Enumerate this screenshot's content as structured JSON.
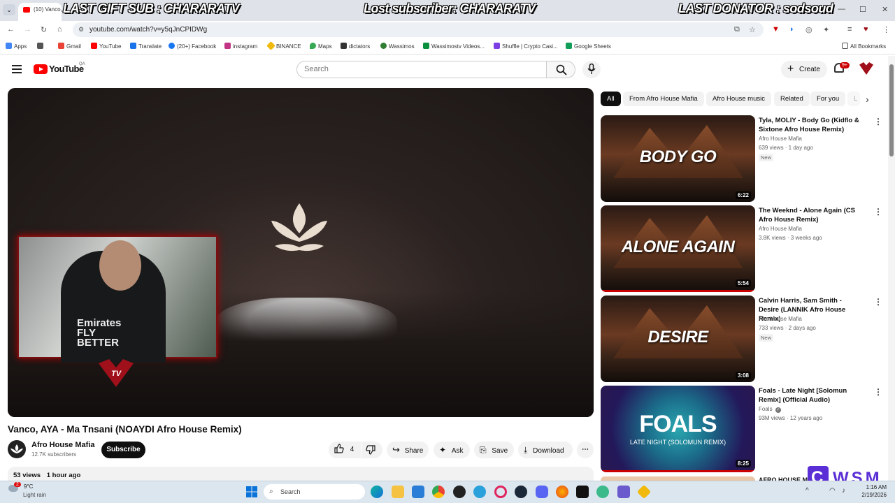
{
  "browser": {
    "tab_title": "(10) Vanco,",
    "banners": {
      "left": "LAST GIFT SUB : CHARARATV",
      "center": "Lost subscriber: CHARARATV",
      "right": "LAST DONATOR : sodsoud"
    },
    "url": "youtube.com/watch?v=y5qJnCPIDWg",
    "bookmarks": [
      "Apps",
      "Gmail",
      "YouTube",
      "Translate",
      "(20+) Facebook",
      "instagram",
      "BINANCE",
      "Maps",
      "dictators",
      "Wassimos",
      "Wassimostv Videos...",
      "Shuffle | Crypto Casi...",
      "Google Sheets"
    ],
    "all_bookmarks": "All Bookmarks",
    "bookmark_colors": [
      "#4285f4",
      "#ea4335",
      "#ff0000",
      "#1a73e8",
      "#1877f2",
      "#c13584",
      "#f0b90b",
      "#34a853",
      "#333333",
      "#2e7d32",
      "#0a8f3c",
      "#7b3fe4",
      "#0f9d58"
    ]
  },
  "youtube": {
    "logo_text": "YouTube",
    "region": "QA",
    "search_placeholder": "Search",
    "create_label": "Create",
    "notif_count": "9+"
  },
  "video": {
    "title": "Vanco, AYA - Ma Tnsani (NOAYDI Afro House Remix)",
    "channel": "Afro House Mafia",
    "subscribers": "12.7K subscribers",
    "subscribe_label": "Subscribe",
    "likes": "4",
    "share_label": "Share",
    "ask_label": "Ask",
    "save_label": "Save",
    "download_label": "Download",
    "views": "53 views",
    "posted": "1 hour ago",
    "overlay_logo_text": "TV",
    "shirt_text": "Emirates FLY BETTER"
  },
  "chips": [
    "All",
    "From Afro House Mafia",
    "Afro House music",
    "Related",
    "For you",
    "L"
  ],
  "recommendations": [
    {
      "title": "Tyla, MOLIY - Body Go (Kidflo & Sixtone Afro House Remix)",
      "thumb_text": "BODY GO",
      "channel": "Afro House Mafia",
      "meta": "639 views · 1 day ago",
      "badge": "New",
      "duration": "6:22"
    },
    {
      "title": "The Weeknd - Alone Again (CS Afro House Remix)",
      "thumb_text": "ALONE AGAIN",
      "channel": "Afro House Mafia",
      "meta": "3.8K views · 3 weeks ago",
      "badge": "",
      "duration": "5:54",
      "watched_fraction": 1.0
    },
    {
      "title": "Calvin Harris, Sam Smith - Desire (LANNIK Afro House Remix)",
      "thumb_text": "DESIRE",
      "channel": "Afro House Mafia",
      "meta": "733 views · 2 days ago",
      "badge": "New",
      "duration": "3:08"
    },
    {
      "title": "Foals - Late Night [Solomun Remix] (Official Audio)",
      "thumb_text": "FOALS",
      "thumb_sub": "LATE NIGHT (SOLOMUN REMIX)",
      "channel": "Foals",
      "meta": "93M views · 12 years ago",
      "badge": "",
      "duration": "8:25",
      "watched_fraction": 1.0
    }
  ],
  "next_partial_title": "AFRO HOUSE MI",
  "watermark": "WSM",
  "taskbar": {
    "temp": "9°C",
    "weather": "Light rain",
    "weather_badge": "2",
    "search_placeholder": "Search",
    "time": "1:16 AM",
    "date": "2/19/2026"
  }
}
